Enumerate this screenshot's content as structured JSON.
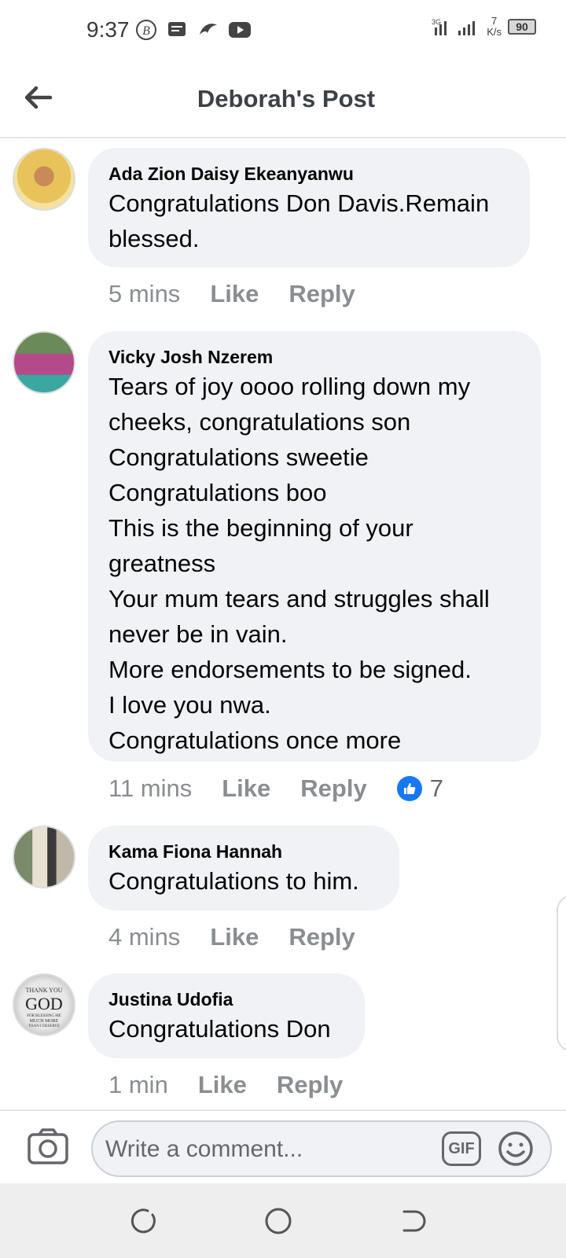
{
  "status_bar": {
    "time": "9:37",
    "icons": [
      "b-circle-icon",
      "message-icon",
      "bird-icon",
      "youtube-icon"
    ],
    "net_speed_value": "7",
    "net_speed_unit": "K/s",
    "battery": "90"
  },
  "header": {
    "title": "Deborah's Post"
  },
  "comments": [
    {
      "author": "Ada Zion Daisy Ekeanyanwu",
      "text": "Congratulations Don Davis.Remain\nblessed.",
      "time": "5 mins",
      "like": "Like",
      "reply": "Reply"
    },
    {
      "author": "Vicky Josh Nzerem",
      "text": "Tears of joy oooo rolling down my\ncheeks,  congratulations son\nCongratulations sweetie\nCongratulations boo\nThis is the beginning of your\ngreatness\nYour mum tears and struggles shall\nnever be in vain.\nMore endorsements to be signed.\nI love you nwa.\nCongratulations once more",
      "time": "11 mins",
      "like": "Like",
      "reply": "Reply",
      "reaction_count": "7"
    },
    {
      "author": "Kama Fiona Hannah",
      "text": "Congratulations to him.",
      "time": "4 mins",
      "like": "Like",
      "reply": "Reply"
    },
    {
      "author": "Justina Udofia",
      "text": "Congratulations Don",
      "time": "1 min",
      "like": "Like",
      "reply": "Reply",
      "avatar_text": "THANK YOU GOD FOR BLESSING ME MUCH MORE THAN I DESERVE"
    }
  ],
  "composer": {
    "placeholder": "Write a comment...",
    "gif_label": "GIF"
  },
  "colors": {
    "bubble": "#f0f2f5",
    "meta_text": "#8a8d91",
    "like_blue": "#1877f2"
  }
}
